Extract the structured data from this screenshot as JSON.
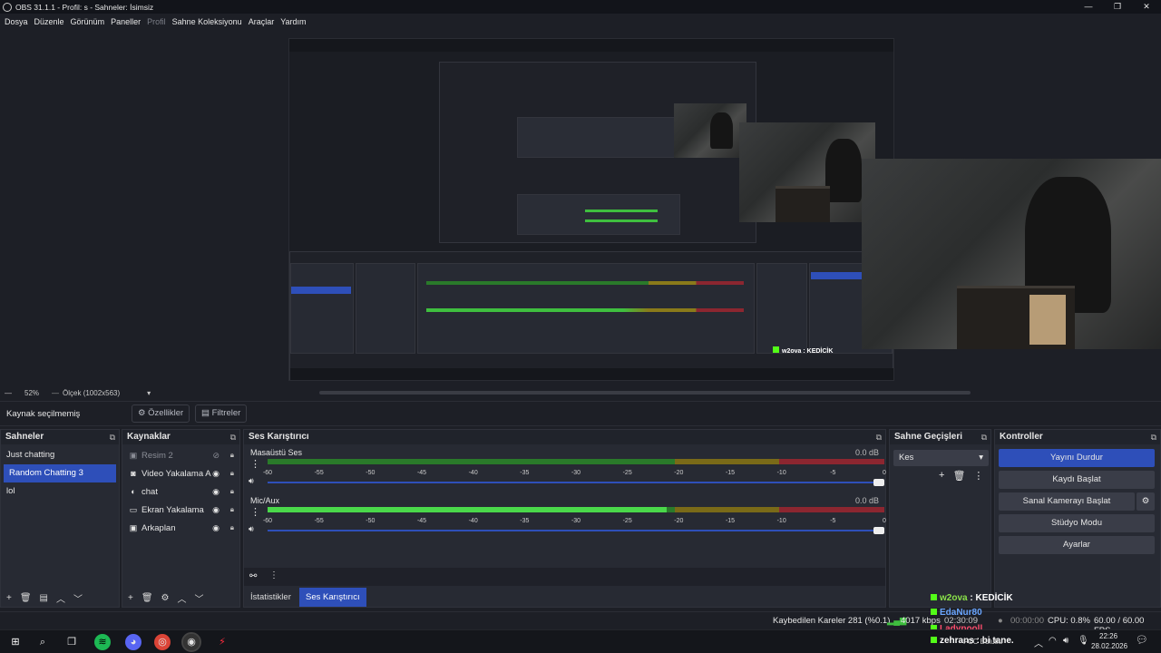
{
  "window": {
    "title": "OBS 31.1.1 - Profil: s - Sahneler: İsimsiz"
  },
  "menu": [
    "Dosya",
    "Düzenle",
    "Görünüm",
    "Paneller",
    "Profil",
    "Sahne Koleksiyonu",
    "Araçlar",
    "Yardım"
  ],
  "preview": {
    "zoom": "52%",
    "scale_mode": "Ölçek (1002x563)"
  },
  "context": {
    "no_source": "Kaynak seçilmemiş",
    "properties": "Özellikler",
    "filters": "Filtreler"
  },
  "scenes": {
    "title": "Sahneler",
    "items": [
      "Just chatting",
      "Random Chatting 3",
      "lol"
    ],
    "selected": 1
  },
  "sources": {
    "title": "Kaynaklar",
    "items": [
      {
        "name": "Resim 2",
        "icon": "image-icon",
        "visible": false
      },
      {
        "name": "Video Yakalama A",
        "icon": "camera-icon",
        "visible": true
      },
      {
        "name": "chat",
        "icon": "globe-icon",
        "visible": true
      },
      {
        "name": "Ekran Yakalama",
        "icon": "monitor-icon",
        "visible": true
      },
      {
        "name": "Arkaplan",
        "icon": "image-icon",
        "visible": true
      }
    ]
  },
  "mixer": {
    "title": "Ses Karıştırıcı",
    "channels": [
      {
        "name": "Masaüstü Ses",
        "db": "0.0 dB",
        "level": 0.0
      },
      {
        "name": "Mic/Aux",
        "db": "0.0 dB",
        "level": 0.65
      }
    ],
    "scale": [
      "-60",
      "-55",
      "-50",
      "-45",
      "-40",
      "-35",
      "-30",
      "-25",
      "-20",
      "-15",
      "-10",
      "-5",
      "0"
    ]
  },
  "transitions": {
    "title": "Sahne Geçişleri",
    "selected": "Kes"
  },
  "controls": {
    "title": "Kontroller",
    "stop_stream": "Yayını Durdur",
    "start_record": "Kaydı Başlat",
    "virtual_cam": "Sanal Kamerayı Başlat",
    "studio_mode": "Stüdyo Modu",
    "settings": "Ayarlar"
  },
  "tabs": {
    "stats": "İstatistikler",
    "mixer": "Ses Karıştırıcı"
  },
  "status": {
    "dropped": "Kaybedilen Kareler 281 (%0.1)",
    "bitrate": "4017 kbps",
    "stream_time": "02:30:09",
    "rec_time": "00:00:00",
    "cpu": "CPU: 0.8%",
    "fps": "60.00 / 60.00 FPS"
  },
  "chat_overlay": [
    {
      "user": "w2ova",
      "msg": "KEDİCİK"
    },
    {
      "user": "EdaNur80",
      "msg": ""
    },
    {
      "user": "Ladypooll",
      "msg": ""
    },
    {
      "user": "zehrans",
      "msg": "bi tane."
    }
  ],
  "chat_overlay_extra": "FCC Bulutlu",
  "taskbar": {
    "time": "22:26",
    "date": "28.02.2026"
  },
  "colors": {
    "accent": "#2e4fb9",
    "meter_green": "#3fbf3f",
    "meter_yellow": "#b8a424",
    "meter_red": "#c0303a"
  }
}
